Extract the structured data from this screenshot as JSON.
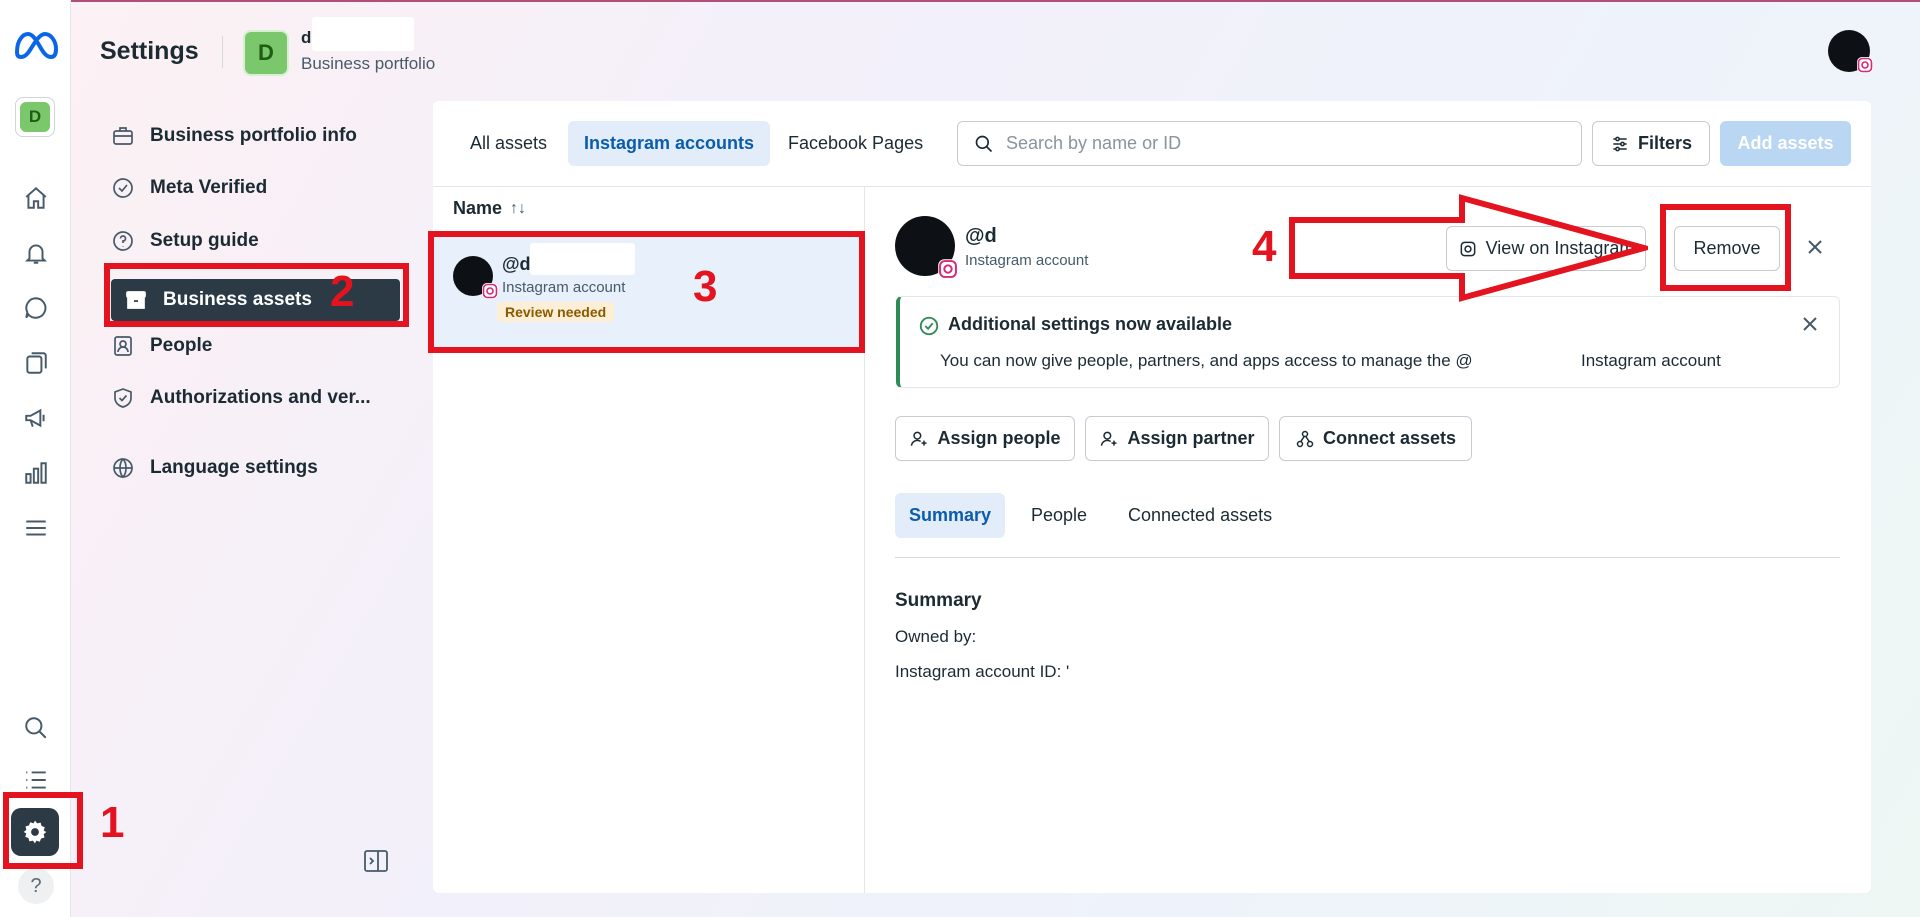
{
  "rail": {
    "portfolio_initial": "D",
    "help_label": "?"
  },
  "header": {
    "title": "Settings",
    "portfolio_initial": "D",
    "portfolio_name": "d",
    "portfolio_sub": "Business portfolio"
  },
  "nav": {
    "items": [
      {
        "label": "Business portfolio info",
        "icon": "briefcase-icon"
      },
      {
        "label": "Meta Verified",
        "icon": "verified-badge-icon"
      },
      {
        "label": "Setup guide",
        "icon": "question-circle-icon"
      },
      {
        "label": "Business assets",
        "icon": "archive-box-icon",
        "active": true
      },
      {
        "label": "People",
        "icon": "people-badge-icon"
      },
      {
        "label": "Authorizations and ver...",
        "icon": "shield-check-icon"
      },
      {
        "label": "Language settings",
        "icon": "globe-icon"
      }
    ]
  },
  "assets": {
    "tabs": [
      "All assets",
      "Instagram accounts",
      "Facebook Pages"
    ],
    "active_tab": "Instagram accounts",
    "search_placeholder": "Search by name or ID",
    "filters_label": "Filters",
    "add_assets_label": "Add assets",
    "list_header": "Name",
    "sort_icon": "↑↓",
    "rows": [
      {
        "handle": "@d",
        "type": "Instagram account",
        "badge": "Review needed"
      }
    ]
  },
  "detail": {
    "handle": "@d",
    "type": "Instagram account",
    "view_label": "View on Instagram",
    "remove_label": "Remove",
    "notice": {
      "title": "Additional settings now available",
      "text": "You can now give people, partners, and apps access to manage the @",
      "text_tail": "Instagram account"
    },
    "actions": [
      "Assign people",
      "Assign partner",
      "Connect assets"
    ],
    "sub_tabs": [
      "Summary",
      "People",
      "Connected assets"
    ],
    "active_sub_tab": "Summary",
    "summary": {
      "title": "Summary",
      "owned_by": "Owned by:",
      "account_id": "Instagram account ID: '"
    }
  },
  "annotations": {
    "step1": "1",
    "step2": "2",
    "step3": "3",
    "step4": "4",
    "color": "#e3131f"
  },
  "colors": {
    "accent": "#0b5cad",
    "active_nav": "#2b3a45",
    "tab_active_bg": "#e2edf9",
    "badge_bg": "#fcefd6",
    "success": "#2e8b57"
  }
}
